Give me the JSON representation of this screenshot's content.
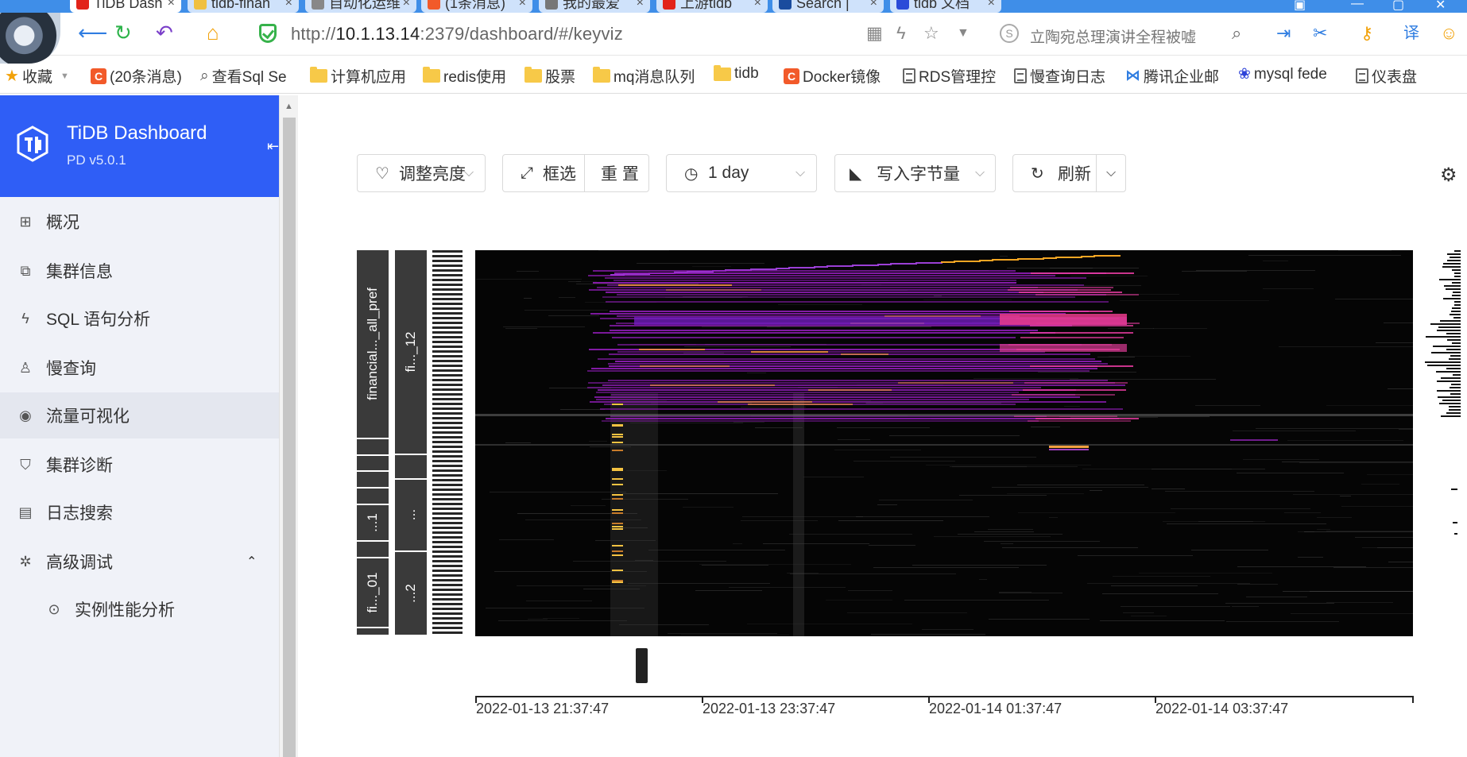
{
  "browser": {
    "tabs": [
      {
        "label": "TiDB Dash",
        "color": "#e2231a"
      },
      {
        "label": "tidb-finan",
        "color": "#f0c040"
      },
      {
        "label": "自动化运维",
        "color": "#888888"
      },
      {
        "label": "(1条消息)",
        "color": "#f25a2a"
      },
      {
        "label": "我的最爱",
        "color": "#777777"
      },
      {
        "label": "上游tidb",
        "color": "#e2231a"
      },
      {
        "label": "Search |",
        "color": "#1a4c9e"
      },
      {
        "label": "tidb 文档",
        "color": "#2b4bd8"
      }
    ],
    "url_prefix": "http://",
    "url_host": "10.1.13.14",
    "url_rest": ":2379/dashboard/#/keyviz",
    "search_hint": "立陶宛总理演讲全程被嘘",
    "bookmarks": [
      {
        "label": "收藏",
        "type": "star"
      },
      {
        "label": "(20条消息)",
        "type": "c"
      },
      {
        "label": "查看Sql Se",
        "type": "link"
      },
      {
        "label": "计算机应用",
        "type": "folder"
      },
      {
        "label": "redis使用",
        "type": "folder"
      },
      {
        "label": "股票",
        "type": "folder"
      },
      {
        "label": "mq消息队列",
        "type": "folder"
      },
      {
        "label": "tidb",
        "type": "folder"
      },
      {
        "label": "Docker镜像",
        "type": "c"
      },
      {
        "label": "RDS管理控",
        "type": "doc"
      },
      {
        "label": "慢查询日志",
        "type": "doc"
      },
      {
        "label": "腾讯企业邮",
        "type": "mail"
      },
      {
        "label": "mysql fede",
        "type": "paw"
      },
      {
        "label": "仪表盘",
        "type": "doc"
      }
    ]
  },
  "sidebar": {
    "title": "TiDB Dashboard",
    "version": "PD v5.0.1",
    "items": [
      {
        "label": "概况",
        "icon": "grid-icon",
        "glyph": "⊞"
      },
      {
        "label": "集群信息",
        "icon": "cluster-icon",
        "glyph": "⧉"
      },
      {
        "label": "SQL 语句分析",
        "icon": "lightning-icon",
        "glyph": "ϟ"
      },
      {
        "label": "慢查询",
        "icon": "bell-icon",
        "glyph": "♙"
      },
      {
        "label": "流量可视化",
        "icon": "eye-icon",
        "glyph": "◉"
      },
      {
        "label": "集群诊断",
        "icon": "shield-icon",
        "glyph": "⛉"
      },
      {
        "label": "日志搜索",
        "icon": "file-search-icon",
        "glyph": "▤"
      },
      {
        "label": "高级调试",
        "icon": "bug-icon",
        "glyph": "✲"
      },
      {
        "label": "实例性能分析",
        "icon": "target-icon",
        "glyph": "⊙"
      }
    ]
  },
  "toolbar": {
    "brightness": "调整亮度",
    "select": "框选",
    "reset": "重 置",
    "range": "1 day",
    "metric": "写入字节量",
    "refresh": "刷新"
  },
  "keyviz": {
    "label_columns": [
      [
        {
          "text": "financial..._all_pref",
          "h": 0.46
        },
        {
          "text": "",
          "h": 0.04
        },
        {
          "text": "",
          "h": 0.04
        },
        {
          "text": "",
          "h": 0.04
        },
        {
          "text": "",
          "h": 0.04
        },
        {
          "text": "...1",
          "h": 0.09
        },
        {
          "text": "",
          "h": 0.04
        },
        {
          "text": "fi..._01",
          "h": 0.17
        },
        {
          "text": "",
          "h": 0.02
        }
      ],
      [
        {
          "text": "fi..._12",
          "h": 0.17
        },
        {
          "text": "",
          "h": 0.02
        },
        {
          "text": "...",
          "h": 0.06
        },
        {
          "text": "...2",
          "h": 0.07
        }
      ]
    ],
    "time_labels": [
      "2022-01-13 21:37:47",
      "2022-01-13 23:37:47",
      "2022-01-14 01:37:47",
      "2022-01-14 03:37:47"
    ]
  }
}
